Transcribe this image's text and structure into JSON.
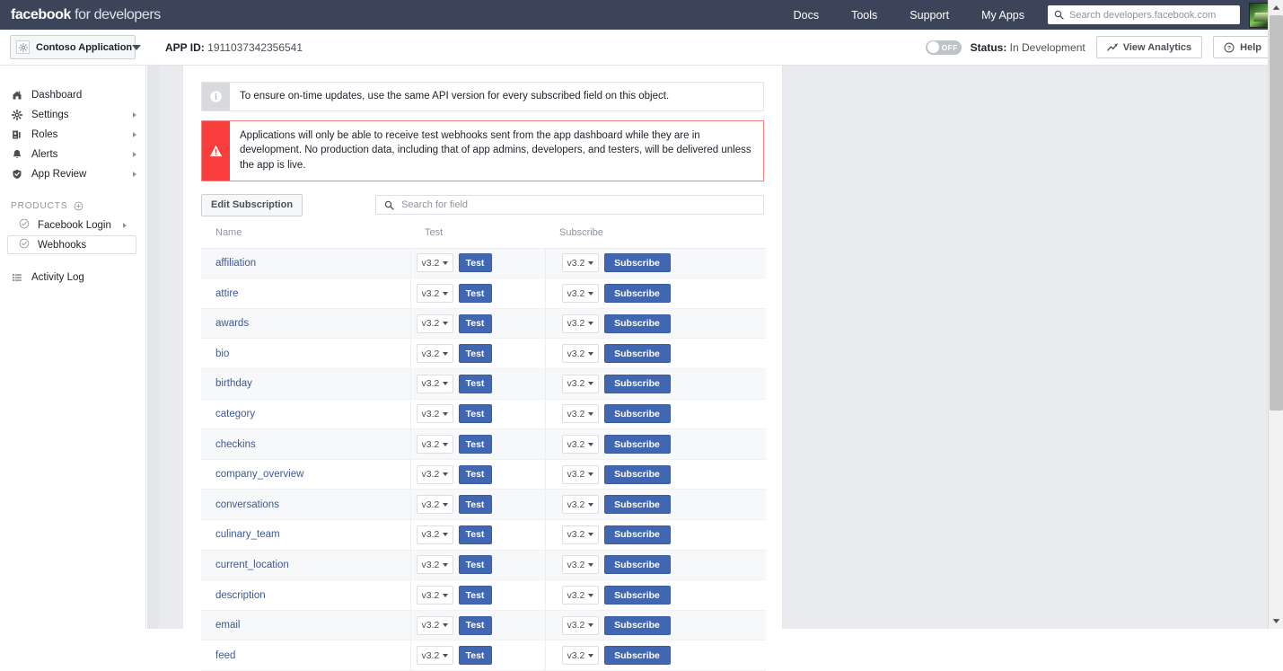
{
  "topbar": {
    "logo_bold": "facebook",
    "logo_light": " for developers",
    "nav": [
      {
        "label": "Docs"
      },
      {
        "label": "Tools"
      },
      {
        "label": "Support"
      },
      {
        "label": "My Apps"
      }
    ],
    "search_placeholder": "Search developers.facebook.com",
    "search_icon": "search-icon",
    "avatar": "user-avatar"
  },
  "subheader": {
    "app_name": "Contoso Application",
    "app_icon": "gear-icon",
    "app_id_label": "APP ID:",
    "app_id_value": "1911037342356541",
    "toggle_state": "OFF",
    "status_label": "Status:",
    "status_value": "In Development",
    "analytics_label": "View Analytics",
    "analytics_icon": "trending-up-icon",
    "help_label": "Help",
    "help_icon": "question-circle-icon"
  },
  "sidebar": {
    "items": [
      {
        "label": "Dashboard",
        "icon": "home-icon",
        "arrow": false
      },
      {
        "label": "Settings",
        "icon": "gear-icon",
        "arrow": true
      },
      {
        "label": "Roles",
        "icon": "people-icon",
        "arrow": true
      },
      {
        "label": "Alerts",
        "icon": "bell-icon",
        "arrow": true
      },
      {
        "label": "App Review",
        "icon": "shield-check-icon",
        "arrow": true
      }
    ],
    "products_header": "PRODUCTS",
    "products_add_icon": "plus-circle-icon",
    "products": [
      {
        "label": "Facebook Login",
        "icon": "check-circle-icon",
        "arrow": true,
        "selected": false
      },
      {
        "label": "Webhooks",
        "icon": "check-circle-icon",
        "arrow": false,
        "selected": true
      }
    ],
    "activity": {
      "label": "Activity Log",
      "icon": "list-icon"
    }
  },
  "main": {
    "info_banner": {
      "icon": "info-icon",
      "text": "To ensure on-time updates, use the same API version for every subscribed field on this object."
    },
    "error_banner": {
      "icon": "warning-triangle-icon",
      "text": "Applications will only be able to receive test webhooks sent from the app dashboard while they are in development. No production data, including that of app admins, developers, and testers, will be delivered unless the app is live."
    },
    "edit_subscription_label": "Edit Subscription",
    "search": {
      "placeholder": "Search for field",
      "value": "",
      "icon": "search-icon"
    },
    "table": {
      "columns": [
        "Name",
        "Test",
        "Subscribe"
      ],
      "test_button_label": "Test",
      "subscribe_button_label": "Subscribe",
      "default_version": "v3.2",
      "rows": [
        {
          "name": "affiliation",
          "test_version": "v3.2",
          "sub_version": "v3.2"
        },
        {
          "name": "attire",
          "test_version": "v3.2",
          "sub_version": "v3.2"
        },
        {
          "name": "awards",
          "test_version": "v3.2",
          "sub_version": "v3.2"
        },
        {
          "name": "bio",
          "test_version": "v3.2",
          "sub_version": "v3.2"
        },
        {
          "name": "birthday",
          "test_version": "v3.2",
          "sub_version": "v3.2"
        },
        {
          "name": "category",
          "test_version": "v3.2",
          "sub_version": "v3.2"
        },
        {
          "name": "checkins",
          "test_version": "v3.2",
          "sub_version": "v3.2"
        },
        {
          "name": "company_overview",
          "test_version": "v3.2",
          "sub_version": "v3.2"
        },
        {
          "name": "conversations",
          "test_version": "v3.2",
          "sub_version": "v3.2"
        },
        {
          "name": "culinary_team",
          "test_version": "v3.2",
          "sub_version": "v3.2"
        },
        {
          "name": "current_location",
          "test_version": "v3.2",
          "sub_version": "v3.2"
        },
        {
          "name": "description",
          "test_version": "v3.2",
          "sub_version": "v3.2"
        },
        {
          "name": "email",
          "test_version": "v3.2",
          "sub_version": "v3.2"
        },
        {
          "name": "feed",
          "test_version": "v3.2",
          "sub_version": "v3.2"
        }
      ]
    }
  },
  "colors": {
    "header_bg": "#3b4459",
    "accent_blue": "#4267b2",
    "link_blue": "#3b5998",
    "error_red": "#fa3e3e",
    "page_bg": "#e9ebee"
  }
}
